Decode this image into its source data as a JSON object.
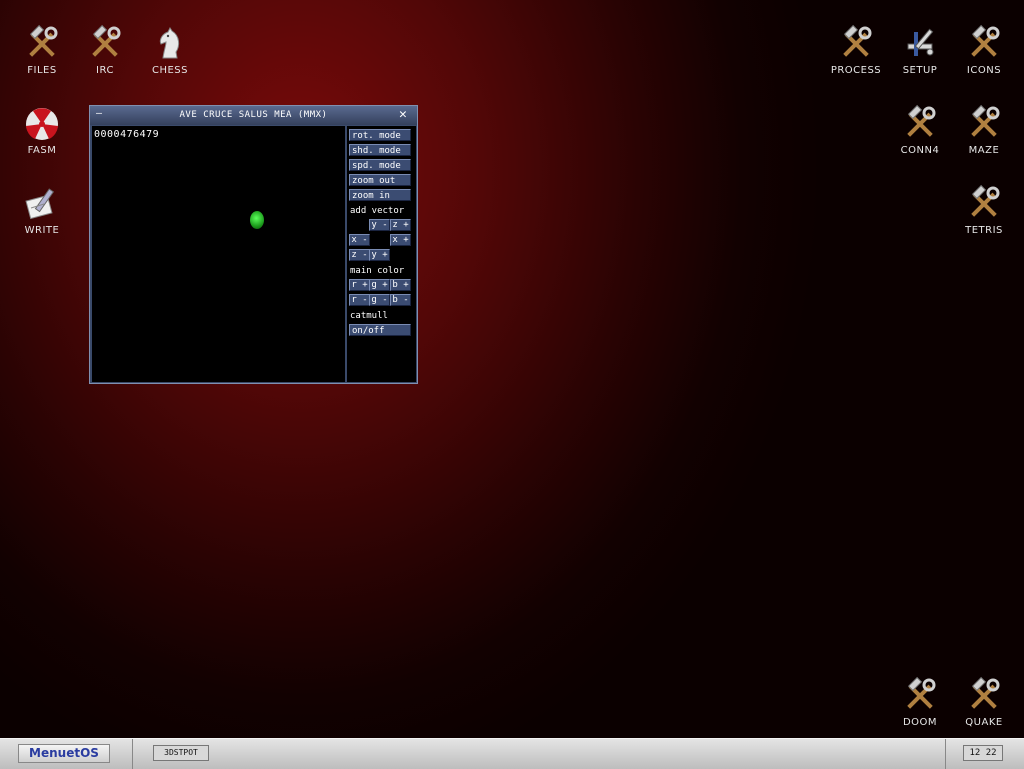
{
  "desktop_icons": {
    "files": {
      "label": "FILES",
      "icon": "tools-icon"
    },
    "irc": {
      "label": "IRC",
      "icon": "tools-icon"
    },
    "chess": {
      "label": "CHESS",
      "icon": "chess-knight-icon"
    },
    "fasm": {
      "label": "FASM",
      "icon": "radiation-icon"
    },
    "write": {
      "label": "WRITE",
      "icon": "pen-icon"
    },
    "process": {
      "label": "PROCESS",
      "icon": "tools-icon"
    },
    "setup": {
      "label": "SETUP",
      "icon": "setup-icon"
    },
    "icons": {
      "label": "ICONS",
      "icon": "tools-icon"
    },
    "conn4": {
      "label": "CONN4",
      "icon": "tools-icon"
    },
    "maze": {
      "label": "MAZE",
      "icon": "tools-icon"
    },
    "tetris": {
      "label": "TETRIS",
      "icon": "tools-icon"
    },
    "doom": {
      "label": "DOOM",
      "icon": "tools-icon"
    },
    "quake": {
      "label": "QUAKE",
      "icon": "tools-icon"
    }
  },
  "window": {
    "title": "AVE CRUCE SALUS MEA (MMX)",
    "minimize_glyph": "—",
    "close_glyph": "✕",
    "counter": "0000476479",
    "buttons": {
      "rot_mode": "rot. mode",
      "shd_mode": "shd. mode",
      "spd_mode": "spd. mode",
      "zoom_out": "zoom out",
      "zoom_in": "zoom in",
      "add_vector_label": "add vector",
      "y_minus": "y -",
      "z_plus": "z +",
      "x_minus": "x -",
      "x_plus": "x +",
      "z_minus": "z -",
      "y_plus": "y +",
      "main_color_label": "main color",
      "r_plus": "r +",
      "g_plus": "g +",
      "b_plus": "b +",
      "r_minus": "r -",
      "g_minus": "g -",
      "b_minus": "b -",
      "catmull_label": "catmull",
      "on_off": "on/off"
    }
  },
  "taskbar": {
    "start_label": "MenuetOS",
    "task_label": "3DSTPOT",
    "clock": "12 22"
  },
  "colors": {
    "desktop_red": "#7a0a0a",
    "window_frame": "#3a4a6a",
    "button_blue": "#3b4c72",
    "object_green": "#3cd83c",
    "start_text": "#2a3ca0"
  }
}
